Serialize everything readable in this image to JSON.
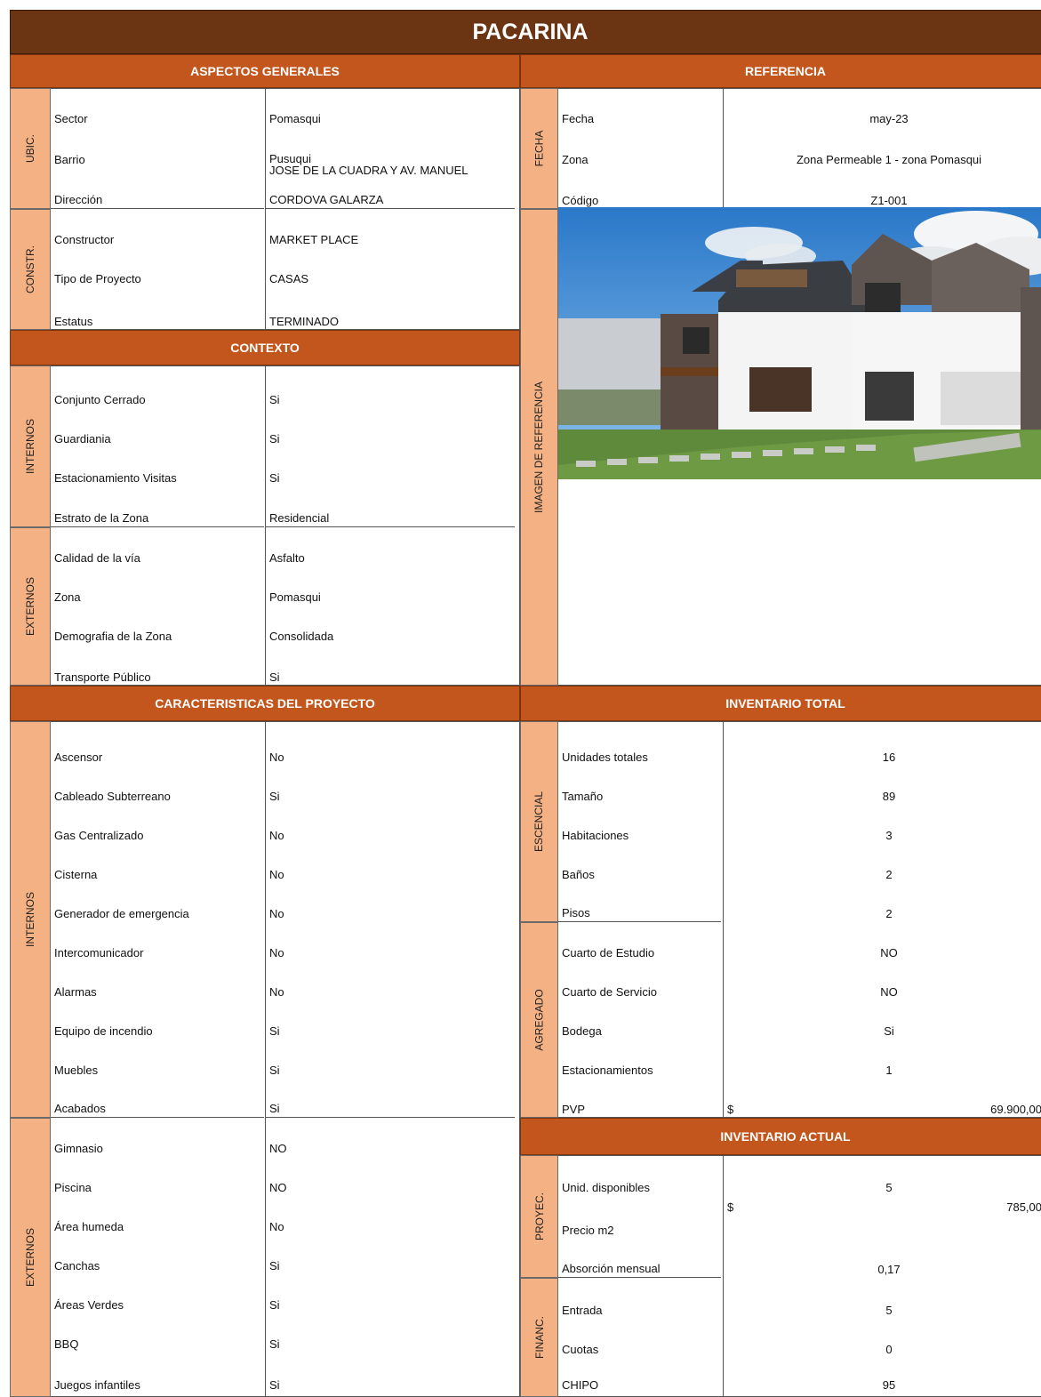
{
  "title": "PACARINA",
  "sections": {
    "aspectos_generales": "ASPECTOS GENERALES",
    "referencia": "REFERENCIA",
    "contexto": "CONTEXTO",
    "caracteristicas": "CARACTERISTICAS DEL PROYECTO",
    "inventario_total": "INVENTARIO TOTAL",
    "inventario_actual": "INVENTARIO ACTUAL"
  },
  "groups": {
    "ubic": "UBIC.",
    "constr": "CONSTR.",
    "internos": "INTERNOS",
    "externos": "EXTERNOS",
    "fecha": "FECHA",
    "imagen": "IMAGEN DE REFERENCIA",
    "escencial": "ESCENCIAL",
    "agregado": "AGREGADO",
    "proyec": "PROYEC.",
    "financ": "FINANC."
  },
  "general": [
    {
      "label": "Sector",
      "value": "Pomasqui"
    },
    {
      "label": "Barrio",
      "value": "Pusuqui"
    },
    {
      "label": "Dirección",
      "value": "JOSE DE LA CUADRA Y AV. MANUEL",
      "value2": "CORDOVA GALARZA"
    },
    {
      "label": "Constructor",
      "value": "MARKET PLACE"
    },
    {
      "label": "Tipo de Proyecto",
      "value": "CASAS"
    },
    {
      "label": "Estatus",
      "value": "TERMINADO"
    }
  ],
  "referencia": [
    {
      "label": "Fecha",
      "value": "may-23"
    },
    {
      "label": "Zona",
      "value": "Zona Permeable 1 - zona Pomasqui"
    },
    {
      "label": "Código",
      "value": "Z1-001"
    }
  ],
  "contexto_internos": [
    {
      "label": "Conjunto Cerrado",
      "value": "Si"
    },
    {
      "label": "Guardiania",
      "value": "Si"
    },
    {
      "label": "Estacionamiento Visitas",
      "value": "Si"
    },
    {
      "label": "Estrato de la Zona",
      "value": "Residencial"
    }
  ],
  "contexto_externos": [
    {
      "label": "Calidad de la vía",
      "value": "Asfalto"
    },
    {
      "label": "Zona",
      "value": "Pomasqui"
    },
    {
      "label": "Demografia de la Zona",
      "value": "Consolidada"
    },
    {
      "label": "Transporte Público",
      "value": "Si"
    }
  ],
  "caracteristicas_internos": [
    {
      "label": "Ascensor",
      "value": "No"
    },
    {
      "label": "Cableado Subterreano",
      "value": "Si"
    },
    {
      "label": "Gas Centralizado",
      "value": "No"
    },
    {
      "label": "Cisterna",
      "value": "No"
    },
    {
      "label": "Generador de emergencia",
      "value": "No"
    },
    {
      "label": "Intercomunicador",
      "value": "No"
    },
    {
      "label": "Alarmas",
      "value": "No"
    },
    {
      "label": "Equipo de incendio",
      "value": "Si"
    },
    {
      "label": "Muebles",
      "value": "Si"
    },
    {
      "label": "Acabados",
      "value": "Si"
    }
  ],
  "caracteristicas_externos": [
    {
      "label": "Gimnasio",
      "value": "NO"
    },
    {
      "label": "Piscina",
      "value": "NO"
    },
    {
      "label": "Área humeda",
      "value": "No"
    },
    {
      "label": "Canchas",
      "value": "Si"
    },
    {
      "label": "Áreas Verdes",
      "value": "Si"
    },
    {
      "label": "BBQ",
      "value": "Si"
    },
    {
      "label": "Juegos infantiles",
      "value": "Si"
    }
  ],
  "inventario_total": [
    {
      "label": "Unidades totales",
      "value": "16"
    },
    {
      "label": "Tamaño",
      "value": "89"
    },
    {
      "label": "Habitaciones",
      "value": "3"
    },
    {
      "label": "Baños",
      "value": "2"
    },
    {
      "label": "Pisos",
      "value": "2"
    },
    {
      "label": "Cuarto de Estudio",
      "value": "NO"
    },
    {
      "label": "Cuarto de Servicio",
      "value": "NO"
    },
    {
      "label": "Bodega",
      "value": "Si"
    },
    {
      "label": "Estacionamientos",
      "value": "1"
    }
  ],
  "pvp": {
    "label": "PVP",
    "currency": "$",
    "value": "69.900,00"
  },
  "inventario_actual": {
    "unid_label": "Unid. disponibles",
    "unid_value": "5",
    "precio_label": "Precio m2",
    "precio_currency": "$",
    "precio_value": "785,00",
    "absorcion_label": "Absorción mensual",
    "absorcion_value": "0,17",
    "entrada_label": "Entrada",
    "entrada_value": "5",
    "cuotas_label": "Cuotas",
    "cuotas_value": "0",
    "chipo_label": "CHIPO",
    "chipo_value": "95"
  }
}
